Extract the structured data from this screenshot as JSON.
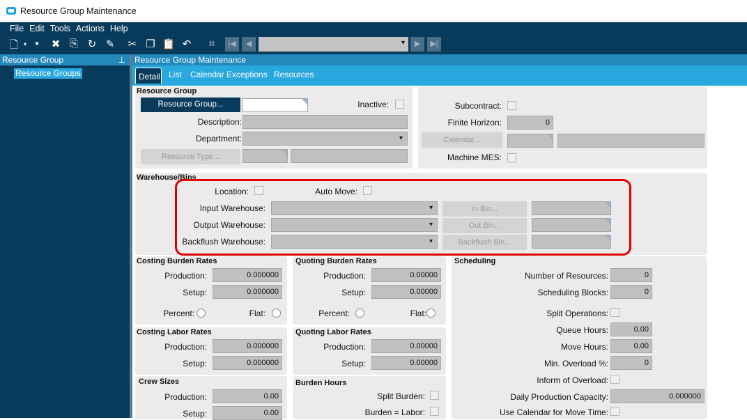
{
  "window": {
    "title": "Resource Group Maintenance"
  },
  "menu": [
    "File",
    "Edit",
    "Tools",
    "Actions",
    "Help"
  ],
  "left": {
    "header": "Resource Group",
    "tree_item": "Resource Groups"
  },
  "main": {
    "header": "Resource Group Maintenance",
    "tabs": [
      "Detail",
      "List",
      "Calendar Exceptions",
      "Resources"
    ],
    "active_tab": "Detail"
  },
  "resource_group": {
    "title": "Resource Group",
    "button": "Resource Group...",
    "inactive": "Inactive:",
    "description": "Description:",
    "department": "Department:",
    "resource_type_button": "Resource Type..."
  },
  "right_top": {
    "subcontract": "Subcontract:",
    "finite_horizon": "Finite Horizon:",
    "finite_horizon_value": "0",
    "calendar_button": "Calendar...",
    "machine_mes": "Machine MES:"
  },
  "warehouse": {
    "title": "Warehouse/Bins",
    "location": "Location:",
    "auto_move": "Auto Move:",
    "input": "Input Warehouse:",
    "output": "Output Warehouse:",
    "backflush": "Backflush Warehouse:",
    "in_bin": "In Bin...",
    "out_bin": "Out Bin...",
    "backflush_bin": "Backflush Bin...",
    "highlight_color": "#e00000"
  },
  "costing_burden": {
    "title": "Costing Burden Rates",
    "production": "Production:",
    "production_value": "0.000000",
    "setup": "Setup:",
    "setup_value": "0.000000",
    "percent": "Percent:",
    "flat": "Flat:"
  },
  "quoting_burden": {
    "title": "Quoting Burden Rates",
    "production": "Production:",
    "production_value": "0.00000",
    "setup": "Setup:",
    "setup_value": "0.00000",
    "percent": "Percent:",
    "flat": "Flat:"
  },
  "costing_labor": {
    "title": "Costing Labor Rates",
    "production": "Production:",
    "production_value": "0.000000",
    "setup": "Setup:",
    "setup_value": "0.000000"
  },
  "quoting_labor": {
    "title": "Quoting Labor Rates",
    "production": "Production:",
    "production_value": "0.00000",
    "setup": "Setup:",
    "setup_value": "0.00000"
  },
  "crew": {
    "title": "Crew Sizes",
    "production": "Production:",
    "production_value": "0.00",
    "setup": "Setup:",
    "setup_value": "0.00"
  },
  "burden_hours": {
    "title": "Burden Hours",
    "split_burden": "Split Burden:",
    "burden_labor": "Burden = Labor:"
  },
  "scheduling": {
    "title": "Scheduling",
    "num_resources": "Number of Resources:",
    "num_resources_value": "0",
    "blocks": "Scheduling Blocks:",
    "blocks_value": "0",
    "split_ops": "Split Operations:",
    "queue": "Queue Hours:",
    "queue_value": "0.00",
    "move": "Move Hours:",
    "move_value": "0.00",
    "min_overload": "Min. Overload %:",
    "min_overload_value": "0",
    "inform": "Inform of Overload:",
    "daily_capacity": "Daily Production Capacity:",
    "daily_capacity_value": "0.000000",
    "use_calendar": "Use Calendar for Move Time:"
  }
}
